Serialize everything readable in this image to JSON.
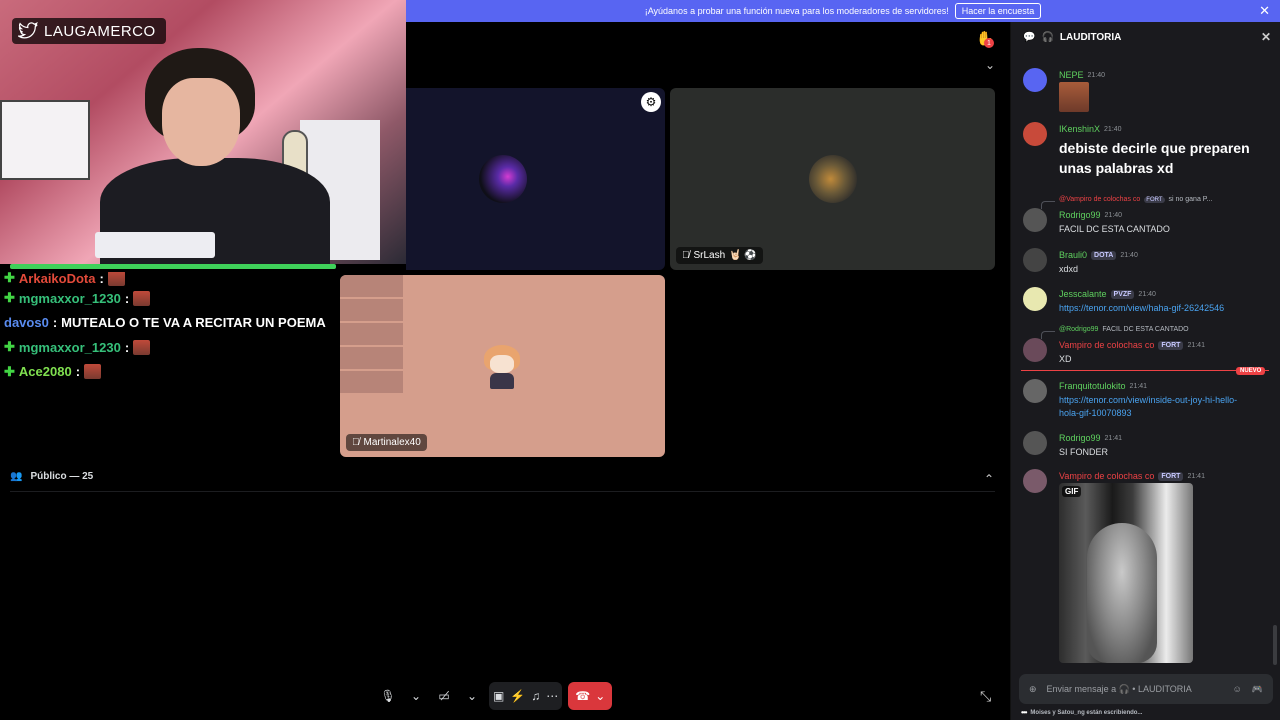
{
  "banner": {
    "text": "¡Ayúdanos a probar una función nueva para los moderadores de servidores!",
    "button": "Hacer la encuesta",
    "close": "✕"
  },
  "stream": {
    "channel": "LAUGAMERCO"
  },
  "tiles": [
    {
      "name": ""
    },
    {
      "name": "SrLash",
      "emoji": "🤘🏻 ⚽"
    },
    {
      "name": "Martinalex40"
    }
  ],
  "hand_badge": "1",
  "twitch_chat": [
    {
      "user": "ArkaikoDota",
      "message": "",
      "cut": true
    },
    {
      "user": "mgmaxxor_1230",
      "message": ""
    },
    {
      "user": "davos0",
      "message": "MUTEALO O TE VA A RECITAR UN POEMA"
    },
    {
      "user": "mgmaxxor_1230",
      "message": ""
    },
    {
      "user": "Ace2080",
      "message": ""
    }
  ],
  "publico": "Público — 25",
  "panel": {
    "channel": "LAUDITORIA",
    "messages": [
      {
        "user": "NEPE",
        "time": "21:40"
      },
      {
        "user": "IKenshinX",
        "time": "21:40",
        "text": "debiste decirle que preparen unas palabras xd"
      },
      {
        "reply_user": "@Vampiro de colochas co",
        "reply_tag": "FORT",
        "reply_text": "si no gana P...",
        "user": "Rodrigo99",
        "time": "21:40",
        "text": "FACIL DC ESTA CANTADO"
      },
      {
        "user": "Brauli0",
        "tag": "DOTA",
        "time": "21:40",
        "text": "xdxd"
      },
      {
        "user": "Jesscalante",
        "tag": "PVZF",
        "time": "21:40",
        "link": "https://tenor.com/view/haha-gif-26242546"
      },
      {
        "reply_user": "@Rodrigo99",
        "reply_text": "FACIL DC ESTA CANTADO",
        "user": "Vampiro de colochas co",
        "tag": "FORT",
        "time": "21:41",
        "text": "XD"
      },
      {
        "user": "Franquitotulokito",
        "time": "21:41",
        "link": "https://tenor.com/view/inside-out-joy-hi-hello-hola-gif-10070893"
      },
      {
        "user": "Rodrigo99",
        "time": "21:41",
        "text": "SI FONDER"
      },
      {
        "user": "Vampiro de colochas co",
        "tag": "FORT",
        "time": "21:41",
        "gif_label": "GIF"
      }
    ],
    "nuevo": "NUEVO",
    "input_placeholder": "Enviar mensaje a 🎧 • LAUDITORIA",
    "typing": "Moises y Satou_ng están escribiendo..."
  },
  "colors": {
    "banner": "#5865f2",
    "hangup": "#da373c",
    "panel_bg": "#1a1a1e",
    "link": "#4aa3f0",
    "nuevo": "#ed4245"
  }
}
